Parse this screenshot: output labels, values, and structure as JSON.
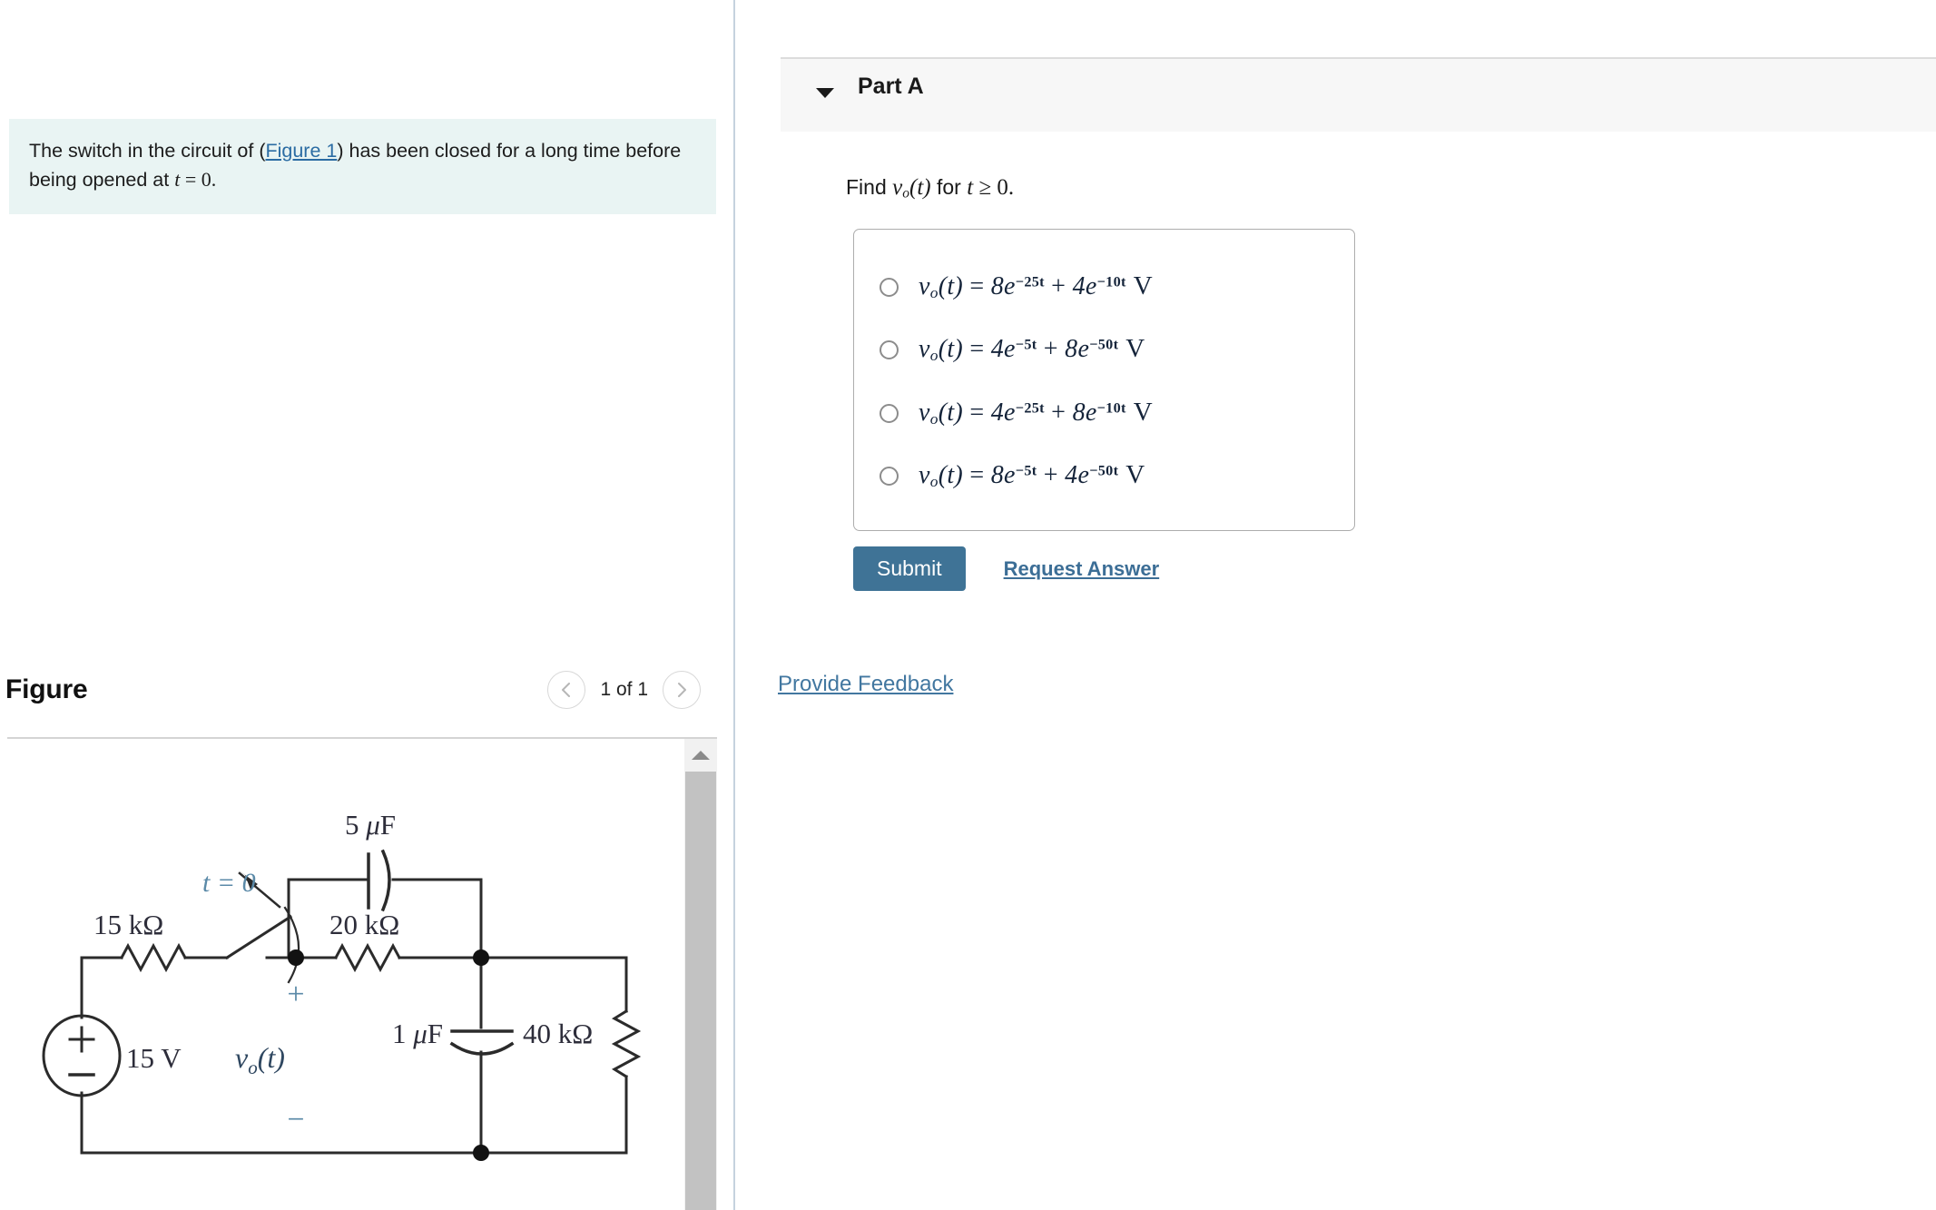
{
  "problem": {
    "text_before_link": "The switch in the circuit of (",
    "figure_link": "Figure 1",
    "text_after_link": ") has been closed for a long time before being opened at ",
    "condition_math": "t = 0.",
    "full_text": "The switch in the circuit of (Figure 1) has been closed for a long time before being opened at t = 0."
  },
  "figure_panel": {
    "title": "Figure",
    "counter": "1 of 1",
    "prev_label": "‹",
    "next_label": "›"
  },
  "circuit": {
    "caption_labels": {
      "cap_top": "5 μF",
      "switch": "t = 0",
      "res_left": "15 kΩ",
      "res_mid": "20 kΩ",
      "source": "15 V",
      "output": "vₒ(t)",
      "cap_right": "1 μF",
      "res_right": "40 kΩ",
      "polarity_plus": "+",
      "polarity_minus": "−"
    },
    "components": [
      {
        "name": "5 μF capacitor",
        "value": "5 μF"
      },
      {
        "name": "switch",
        "value": "t = 0"
      },
      {
        "name": "15 kΩ resistor",
        "value": "15 kΩ"
      },
      {
        "name": "20 kΩ resistor",
        "value": "20 kΩ"
      },
      {
        "name": "voltage source",
        "value": "15 V"
      },
      {
        "name": "output voltage",
        "value": "vₒ(t)"
      },
      {
        "name": "1 μF capacitor",
        "value": "1 μF"
      },
      {
        "name": "40 kΩ resistor",
        "value": "40 kΩ"
      }
    ]
  },
  "part": {
    "title": "Part A",
    "caret": "▼",
    "question_prefix": "Find ",
    "question_math": "vₒ(t)",
    "question_middle": " for ",
    "question_condition": "t ≥ 0.",
    "question_full": "Find vₒ(t) for t ≥ 0."
  },
  "choices": [
    {
      "id": "choice-1",
      "text": "vₒ(t) = 8e⁻²⁵ᵗ + 4e⁻¹⁰ᵗ V",
      "lhs": "v",
      "sub": "o",
      "coef1": "8",
      "exp1": "−25t",
      "coef2": "4",
      "exp2": "−10t",
      "unit": "V",
      "selected": false
    },
    {
      "id": "choice-2",
      "text": "vₒ(t) = 4e⁻⁵ᵗ + 8e⁻⁵⁰ᵗ V",
      "lhs": "v",
      "sub": "o",
      "coef1": "4",
      "exp1": "−5t",
      "coef2": "8",
      "exp2": "−50t",
      "unit": "V",
      "selected": false
    },
    {
      "id": "choice-3",
      "text": "vₒ(t) = 4e⁻²⁵ᵗ + 8e⁻¹⁰ᵗ V",
      "lhs": "v",
      "sub": "o",
      "coef1": "4",
      "exp1": "−25t",
      "coef2": "8",
      "exp2": "−10t",
      "unit": "V",
      "selected": false
    },
    {
      "id": "choice-4",
      "text": "vₒ(t) = 8e⁻⁵ᵗ + 4e⁻⁵⁰ᵗ V",
      "lhs": "v",
      "sub": "o",
      "coef1": "8",
      "exp1": "−5t",
      "coef2": "4",
      "exp2": "−50t",
      "unit": "V",
      "selected": false
    }
  ],
  "actions": {
    "submit_label": "Submit",
    "request_answer_label": "Request Answer",
    "provide_feedback_label": "Provide Feedback"
  },
  "colors": {
    "submit_bg": "#3f7396",
    "link": "#3c6e96",
    "problem_bg": "#e9f4f3",
    "part_header_bg": "#f7f7f7",
    "circuit_accent": "#5b8aa8"
  }
}
